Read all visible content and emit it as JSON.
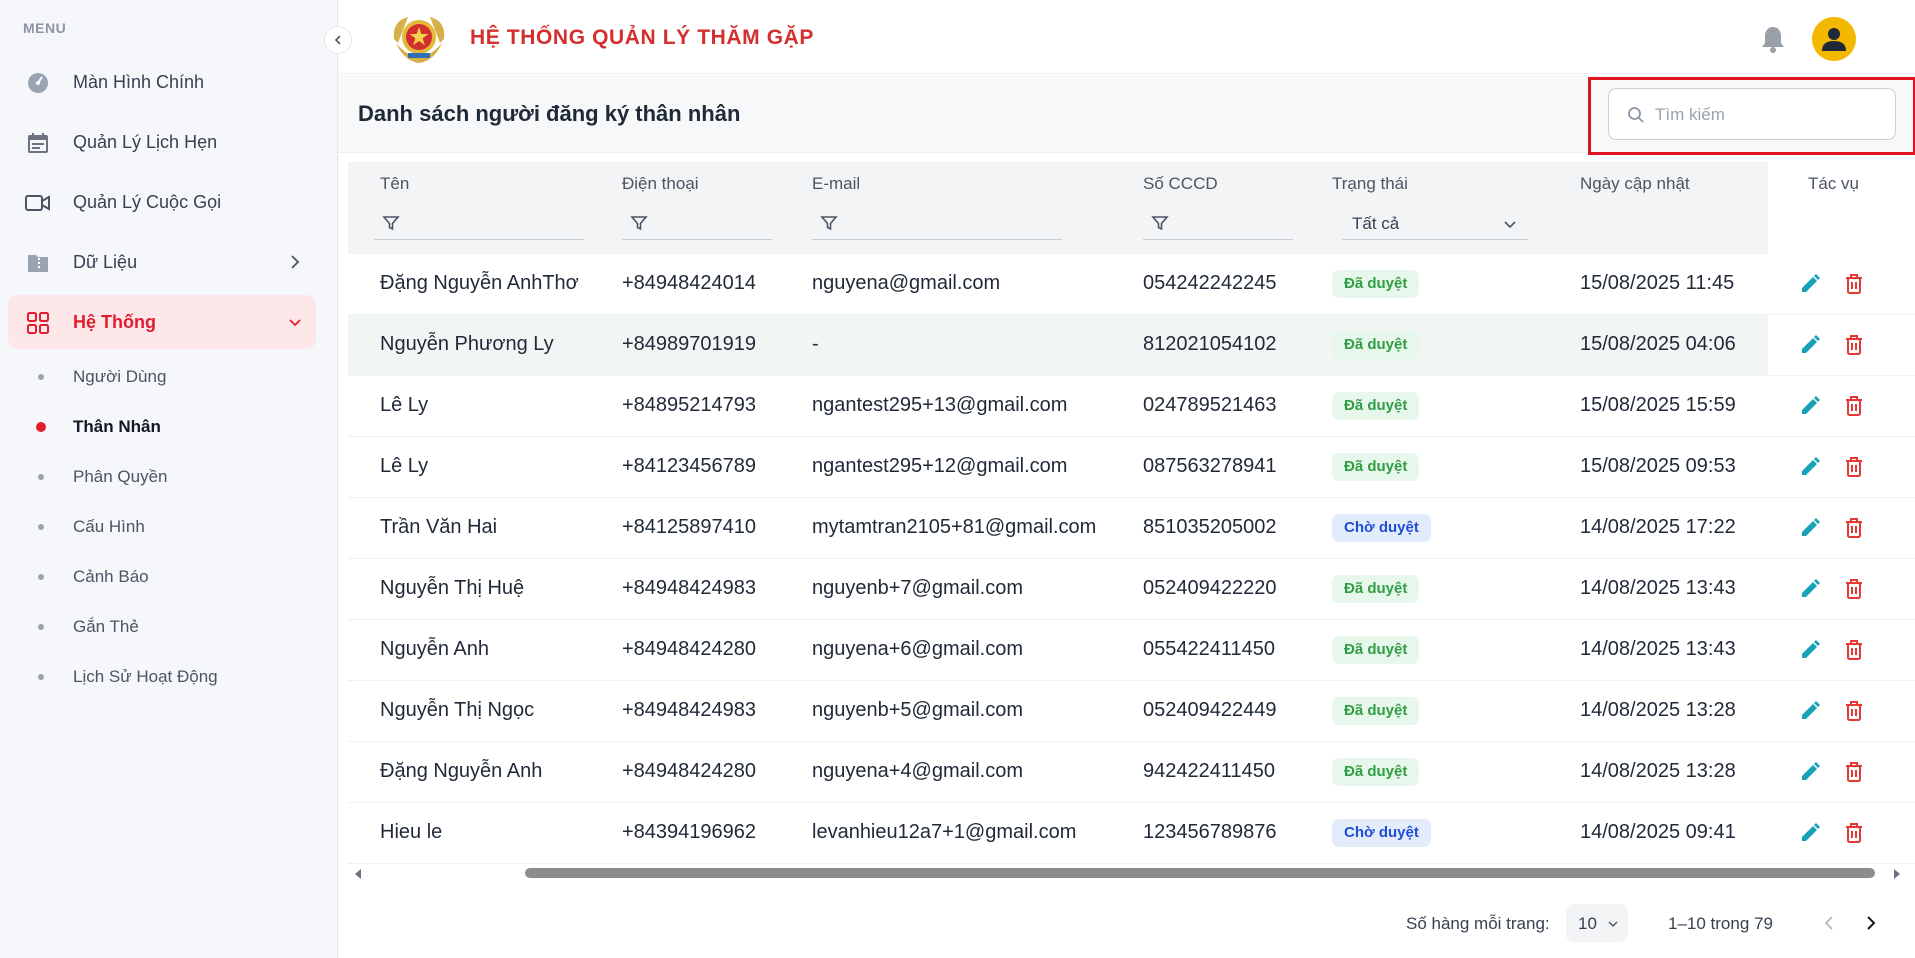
{
  "sidebar": {
    "menu_label": "MENU",
    "items": [
      {
        "label": "Màn Hình Chính",
        "icon": "dashboard-gauge-icon"
      },
      {
        "label": "Quản Lý Lịch Hẹn",
        "icon": "calendar-icon"
      },
      {
        "label": "Quản Lý Cuộc Gọi",
        "icon": "video-camera-icon"
      },
      {
        "label": "Dữ Liệu",
        "icon": "folder-zip-icon"
      },
      {
        "label": "Hệ Thống",
        "icon": "grid-icon"
      }
    ],
    "subitems": [
      {
        "label": "Người Dùng"
      },
      {
        "label": "Thân Nhân"
      },
      {
        "label": "Phân Quyền"
      },
      {
        "label": "Cấu Hình"
      },
      {
        "label": "Cảnh Báo"
      },
      {
        "label": "Gắn Thẻ"
      },
      {
        "label": "Lịch Sử Hoạt Động"
      }
    ]
  },
  "header": {
    "title": "HỆ THỐNG QUẢN LÝ THĂM GẶP"
  },
  "page": {
    "title": "Danh sách người đăng ký thân nhân",
    "search_placeholder": "Tìm kiếm"
  },
  "table": {
    "columns": {
      "name": "Tên",
      "phone": "Điện thoại",
      "email": "E-mail",
      "cccd": "Số CCCD",
      "status": "Trạng thái",
      "updated": "Ngày cập nhật",
      "actions": "Tác vụ"
    },
    "status_filter_value": "Tất cả",
    "rows": [
      {
        "name": "Đặng Nguyễn AnhThơ",
        "phone": "+84948424014",
        "email": "nguyena@gmail.com",
        "cccd": "054242242245",
        "status": "Đã duyệt",
        "updated": "15/08/2025 11:45"
      },
      {
        "name": "Nguyễn Phương Ly",
        "phone": "+84989701919",
        "email": "-",
        "cccd": "812021054102",
        "status": "Đã duyệt",
        "updated": "15/08/2025 04:06"
      },
      {
        "name": "Lê Ly",
        "phone": "+84895214793",
        "email": "ngantest295+13@gmail.com",
        "cccd": "024789521463",
        "status": "Đã duyệt",
        "updated": "15/08/2025 15:59"
      },
      {
        "name": "Lê Ly",
        "phone": "+84123456789",
        "email": "ngantest295+12@gmail.com",
        "cccd": "087563278941",
        "status": "Đã duyệt",
        "updated": "15/08/2025 09:53"
      },
      {
        "name": "Trần Văn Hai",
        "phone": "+84125897410",
        "email": "mytamtran2105+81@gmail.com",
        "cccd": "851035205002",
        "status": "Chờ duyệt",
        "updated": "14/08/2025 17:22"
      },
      {
        "name": "Nguyễn Thị Huệ",
        "phone": "+84948424983",
        "email": "nguyenb+7@gmail.com",
        "cccd": "052409422220",
        "status": "Đã duyệt",
        "updated": "14/08/2025 13:43"
      },
      {
        "name": "Nguyễn Anh",
        "phone": "+84948424280",
        "email": "nguyena+6@gmail.com",
        "cccd": "055422411450",
        "status": "Đã duyệt",
        "updated": "14/08/2025 13:43"
      },
      {
        "name": "Nguyễn Thị Ngọc",
        "phone": "+84948424983",
        "email": "nguyenb+5@gmail.com",
        "cccd": "052409422449",
        "status": "Đã duyệt",
        "updated": "14/08/2025 13:28"
      },
      {
        "name": "Đặng Nguyễn Anh",
        "phone": "+84948424280",
        "email": "nguyena+4@gmail.com",
        "cccd": "942422411450",
        "status": "Đã duyệt",
        "updated": "14/08/2025 13:28"
      },
      {
        "name": "Hieu le",
        "phone": "+84394196962",
        "email": "levanhieu12a7+1@gmail.com",
        "cccd": "123456789876",
        "status": "Chờ duyệt",
        "updated": "14/08/2025 09:41"
      }
    ]
  },
  "pagination": {
    "rows_per_page_label": "Số hàng mỗi trang:",
    "rows_per_page": "10",
    "range": "1–10 trong 79"
  },
  "colors": {
    "brand_red": "#d32f2f",
    "active_red": "#e11d2e",
    "approved_green": "#2f9e44",
    "pending_blue": "#1d4ed8",
    "edit_teal": "#17a2b8",
    "delete_red": "#e53935",
    "avatar_yellow": "#f5b800"
  }
}
